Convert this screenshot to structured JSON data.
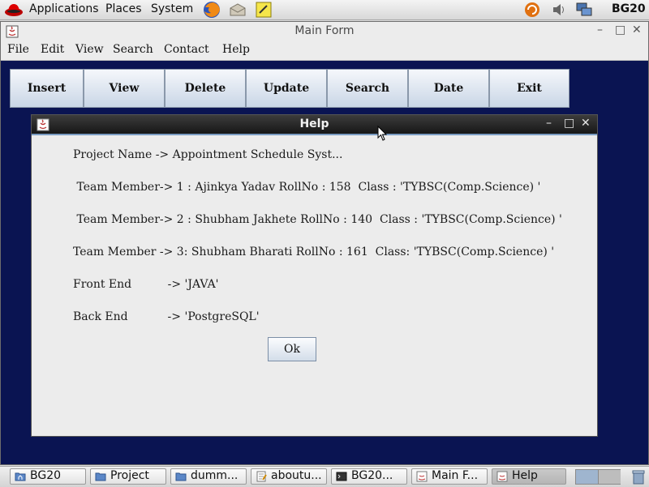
{
  "top_panel": {
    "menus": [
      "Applications",
      "Places",
      "System"
    ],
    "launchers": [
      "firefox-icon",
      "mail-icon",
      "notes-icon"
    ],
    "tray_icons": [
      "update-icon",
      "volume-icon",
      "network-icon"
    ],
    "hostname": "BG20"
  },
  "main_window": {
    "title": "Main Form",
    "menu": [
      "File",
      "Edit",
      "View",
      "Search",
      "Contact",
      "Help"
    ],
    "toolbar": [
      "Insert",
      "View",
      "Delete",
      "Update",
      "Search",
      "Date",
      "Exit"
    ],
    "background_color": "#0a1452"
  },
  "help_dialog": {
    "title": "Help",
    "lines": [
      "Project Name -> Appointment Schedule Syst...",
      " Team Member-> 1 : Ajinkya Yadav RollNo : 158  Class : 'TYBSC(Comp.Science) '",
      " Team Member-> 2 : Shubham Jakhete RollNo : 140  Class : 'TYBSC(Comp.Science) '",
      "Team Member -> 3: Shubham Bharati RollNo : 161  Class: 'TYBSC(Comp.Science) '",
      "Front End          -> 'JAVA'",
      "Back End           -> 'PostgreSQL'"
    ],
    "ok_label": "Ok"
  },
  "taskbar": {
    "tasks": [
      {
        "label": "BG20",
        "icon": "home-folder-icon",
        "active": false
      },
      {
        "label": "Project",
        "icon": "folder-icon",
        "active": false
      },
      {
        "label": "dumm...",
        "icon": "folder-icon",
        "active": false
      },
      {
        "label": "aboutu...",
        "icon": "text-editor-icon",
        "active": false
      },
      {
        "label": "BG20...",
        "icon": "terminal-icon",
        "active": false
      },
      {
        "label": "Main F...",
        "icon": "java-icon",
        "active": false
      },
      {
        "label": "Help",
        "icon": "java-icon",
        "active": true
      }
    ]
  }
}
